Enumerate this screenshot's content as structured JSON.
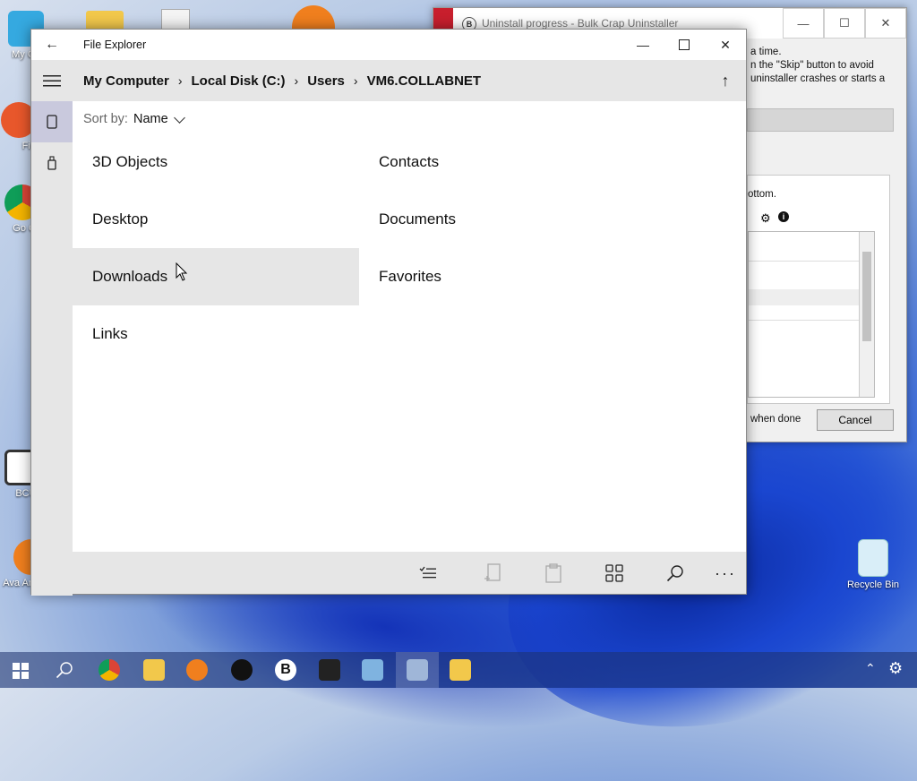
{
  "desktop": {
    "icons": [
      {
        "label": "My Co"
      },
      {
        "label": "Fir"
      },
      {
        "label": "Go Chr"
      },
      {
        "label": "BCUn"
      },
      {
        "label": "Ava Antivirus"
      },
      {
        "label": "Recycle Bin"
      }
    ]
  },
  "bcu_window": {
    "title": "Uninstall progress - Bulk Crap Uninstaller",
    "text_line1": "a time.",
    "text_line2": "n the \"Skip\" button to avoid",
    "text_line3": "uninstaller crashes or starts a",
    "text_bottom": "ottom.",
    "when_done": "when done",
    "cancel_label": "Cancel"
  },
  "explorer": {
    "title": "File Explorer",
    "breadcrumb": [
      "My Computer",
      "Local Disk (C:)",
      "Users",
      "VM6.COLLABNET"
    ],
    "sort_label": "Sort by:",
    "sort_value": "Name",
    "items": [
      {
        "name": "3D Objects"
      },
      {
        "name": "Contacts"
      },
      {
        "name": "Desktop"
      },
      {
        "name": "Documents"
      },
      {
        "name": "Downloads"
      },
      {
        "name": "Favorites"
      },
      {
        "name": "Links"
      }
    ]
  }
}
